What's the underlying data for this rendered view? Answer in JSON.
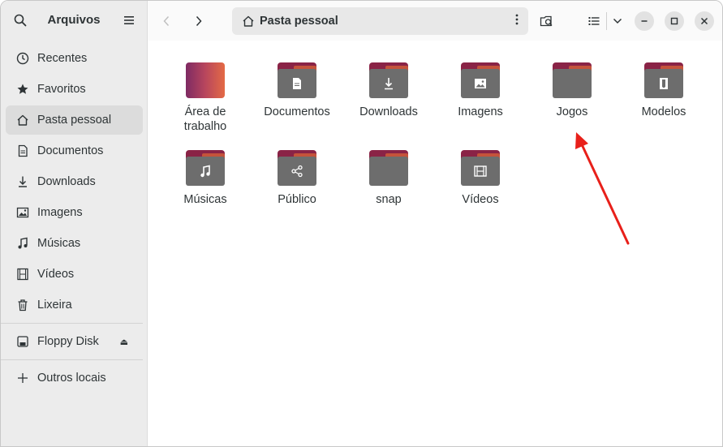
{
  "sidebar": {
    "title": "Arquivos",
    "items": [
      {
        "label": "Recentes",
        "icon": "clock-icon"
      },
      {
        "label": "Favoritos",
        "icon": "star-icon"
      },
      {
        "label": "Pasta pessoal",
        "icon": "home-icon",
        "active": true
      },
      {
        "label": "Documentos",
        "icon": "document-icon"
      },
      {
        "label": "Downloads",
        "icon": "download-icon"
      },
      {
        "label": "Imagens",
        "icon": "image-icon"
      },
      {
        "label": "Músicas",
        "icon": "music-icon"
      },
      {
        "label": "Vídeos",
        "icon": "film-icon"
      },
      {
        "label": "Lixeira",
        "icon": "trash-icon"
      }
    ],
    "devices": [
      {
        "label": "Floppy Disk",
        "icon": "floppy-icon",
        "eject": "⏏"
      }
    ],
    "other": {
      "label": "Outros locais",
      "icon": "plus-icon"
    }
  },
  "header": {
    "path_label": "Pasta pessoal",
    "path_icon": "home-icon"
  },
  "files": [
    {
      "label": "Área de trabalho",
      "icon": "desktop-folder"
    },
    {
      "label": "Documentos",
      "icon": "document-icon"
    },
    {
      "label": "Downloads",
      "icon": "download-icon"
    },
    {
      "label": "Imagens",
      "icon": "image-icon"
    },
    {
      "label": "Jogos",
      "icon": "folder"
    },
    {
      "label": "Modelos",
      "icon": "template-icon"
    },
    {
      "label": "Músicas",
      "icon": "music-icon"
    },
    {
      "label": "Público",
      "icon": "share-icon"
    },
    {
      "label": "snap",
      "icon": "folder"
    },
    {
      "label": "Vídeos",
      "icon": "film-icon"
    }
  ],
  "colors": {
    "folder_body": "#6d6d6d",
    "folder_tab": "#8a2346",
    "folder_tab_accent": "#c4533b",
    "annotation_arrow": "#e8201a"
  }
}
